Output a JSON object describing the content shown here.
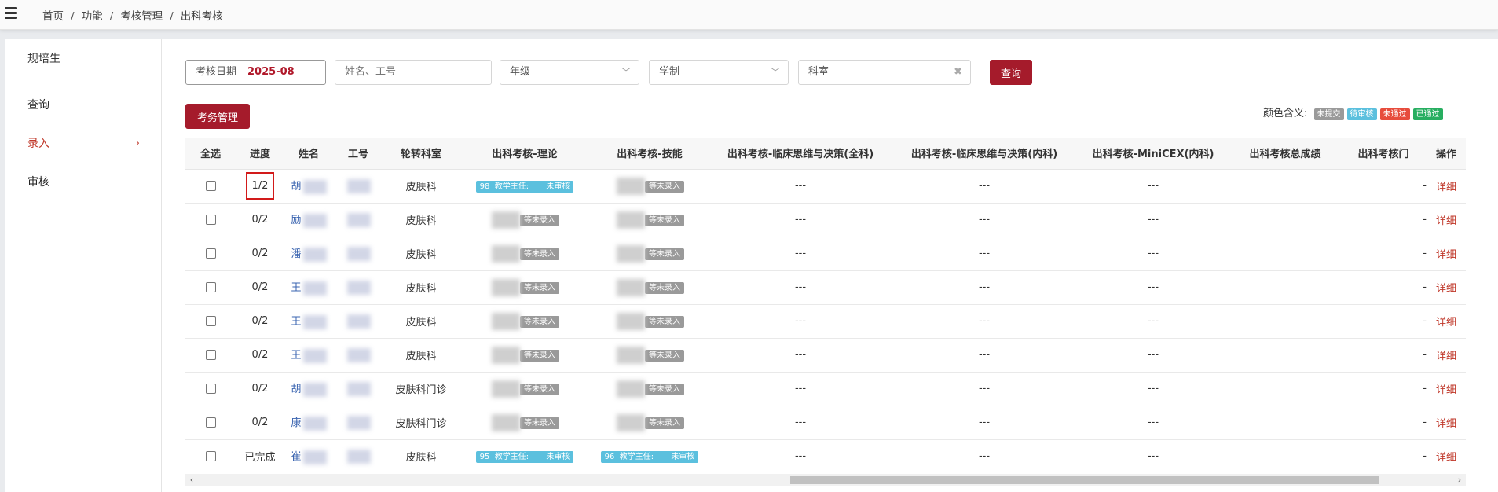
{
  "breadcrumb": [
    "首页",
    "功能",
    "考核管理",
    "出科考核"
  ],
  "sidebar": {
    "header": "规培生",
    "items": [
      {
        "label": "查询",
        "active": false
      },
      {
        "label": "录入",
        "active": true,
        "chevron": "›"
      },
      {
        "label": "审核",
        "active": false
      }
    ]
  },
  "filters": {
    "date_label": "考核日期",
    "date_value": "2025-08",
    "name_placeholder": "姓名、工号",
    "grade_placeholder": "年级",
    "schooling_placeholder": "学制",
    "dept_placeholder": "科室",
    "query_label": "查询"
  },
  "exam_admin_label": "考务管理",
  "legend": {
    "label": "颜色含义:",
    "items": [
      {
        "label": "未提交",
        "color": "#9a9a9a"
      },
      {
        "label": "待审核",
        "color": "#5bc0de"
      },
      {
        "label": "未通过",
        "color": "#e74c3c"
      },
      {
        "label": "已通过",
        "color": "#27ae60"
      }
    ]
  },
  "table": {
    "headers": [
      "全选",
      "进度",
      "姓名",
      "工号",
      "轮转科室",
      "出科考核-理论",
      "出科考核-技能",
      "出科考核-临床思维与决策(全科)",
      "出科考核-临床思维与决策(内科)",
      "出科考核-MiniCEX(内科)",
      "出科考核总成绩",
      "出科考核门",
      "操作"
    ],
    "rows": [
      {
        "progress": "1/2",
        "name": "胡",
        "dept": "皮肤科",
        "theory": {
          "score": "98",
          "teacher": "教学主任:",
          "status": "未审核"
        },
        "skill": {
          "status": "等未录入"
        },
        "gp": "---",
        "im": "---",
        "mini": "---",
        "total": "",
        "door": "-",
        "action": "详细"
      },
      {
        "progress": "0/2",
        "name": "励",
        "dept": "皮肤科",
        "theory": {
          "status": "等未录入"
        },
        "skill": {
          "status": "等未录入"
        },
        "gp": "---",
        "im": "---",
        "mini": "---",
        "total": "",
        "door": "-",
        "action": "详细"
      },
      {
        "progress": "0/2",
        "name": "潘",
        "dept": "皮肤科",
        "theory": {
          "status": "等未录入"
        },
        "skill": {
          "status": "等未录入"
        },
        "gp": "---",
        "im": "---",
        "mini": "---",
        "total": "",
        "door": "-",
        "action": "详细"
      },
      {
        "progress": "0/2",
        "name": "王",
        "dept": "皮肤科",
        "theory": {
          "status": "等未录入"
        },
        "skill": {
          "status": "等未录入"
        },
        "gp": "---",
        "im": "---",
        "mini": "---",
        "total": "",
        "door": "-",
        "action": "详细"
      },
      {
        "progress": "0/2",
        "name": "王",
        "dept": "皮肤科",
        "theory": {
          "status": "等未录入"
        },
        "skill": {
          "status": "等未录入"
        },
        "gp": "---",
        "im": "---",
        "mini": "---",
        "total": "",
        "door": "-",
        "action": "详细"
      },
      {
        "progress": "0/2",
        "name": "王",
        "dept": "皮肤科",
        "theory": {
          "status": "等未录入"
        },
        "skill": {
          "status": "等未录入"
        },
        "gp": "---",
        "im": "---",
        "mini": "---",
        "total": "",
        "door": "-",
        "action": "详细"
      },
      {
        "progress": "0/2",
        "name": "胡",
        "dept": "皮肤科门诊",
        "theory": {
          "status": "等未录入"
        },
        "skill": {
          "status": "等未录入"
        },
        "gp": "---",
        "im": "---",
        "mini": "---",
        "total": "",
        "door": "-",
        "action": "详细"
      },
      {
        "progress": "0/2",
        "name": "康",
        "dept": "皮肤科门诊",
        "theory": {
          "status": "等未录入"
        },
        "skill": {
          "status": "等未录入"
        },
        "gp": "---",
        "im": "---",
        "mini": "---",
        "total": "",
        "door": "-",
        "action": "详细"
      },
      {
        "progress": "已完成",
        "name": "崔",
        "dept": "皮肤科",
        "theory": {
          "score": "95",
          "teacher": "教学主任:",
          "status": "未审核"
        },
        "skill": {
          "score": "96",
          "teacher": "教学主任:",
          "status": "未审核"
        },
        "gp": "---",
        "im": "---",
        "mini": "---",
        "total": "",
        "door": "-",
        "action": "详细"
      }
    ]
  },
  "scroll": {
    "left_arrow": "‹",
    "right_arrow": "›"
  }
}
